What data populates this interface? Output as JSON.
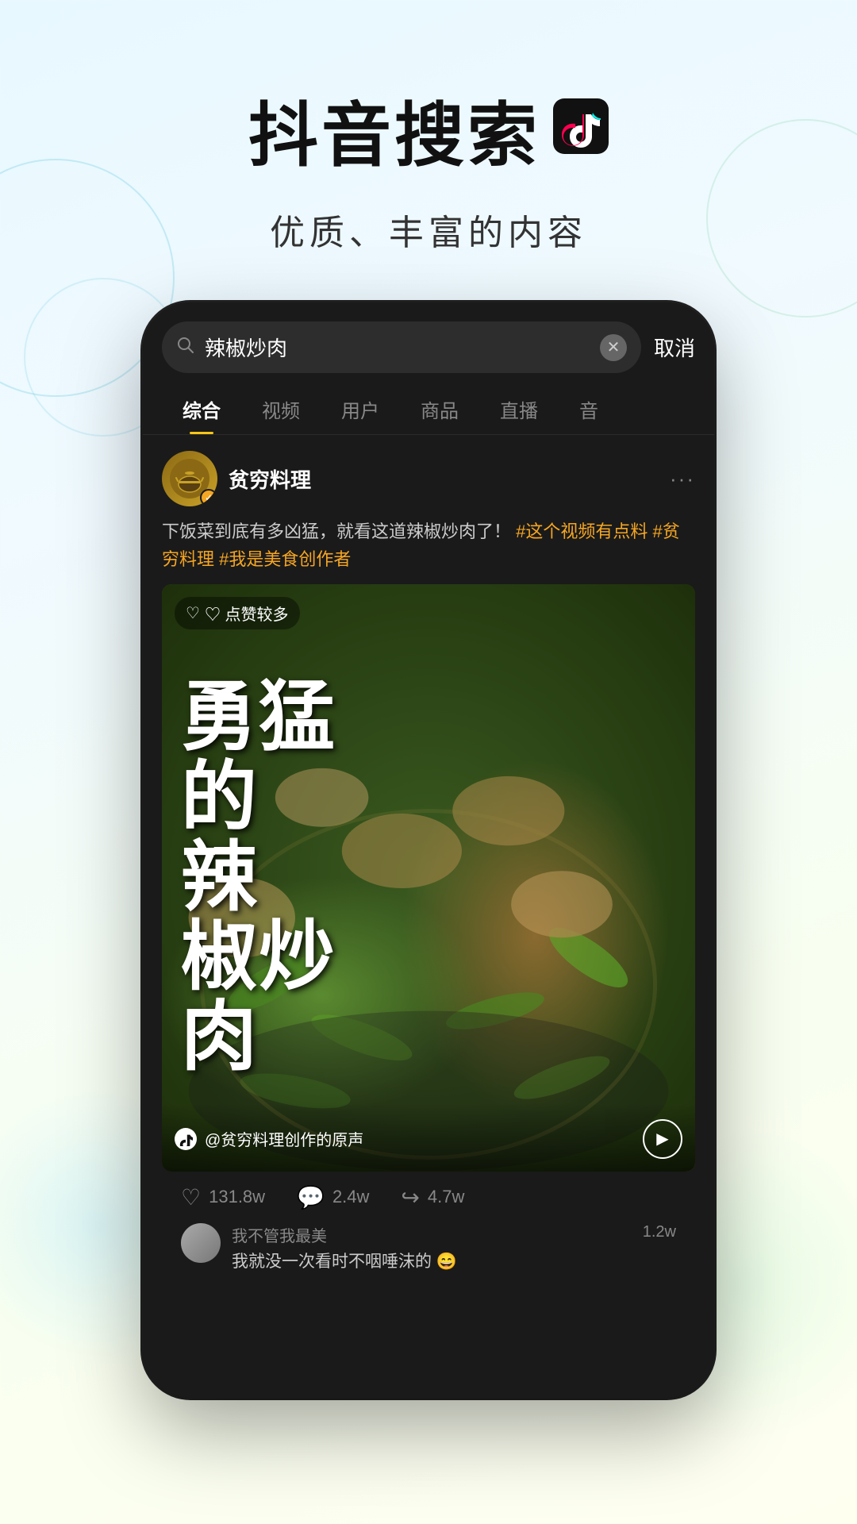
{
  "header": {
    "main_title": "抖音搜索",
    "tiktok_symbol": "♪",
    "subtitle": "优质、丰富的内容"
  },
  "phone": {
    "search_bar": {
      "query": "辣椒炒肉",
      "cancel_label": "取消"
    },
    "tabs": [
      {
        "label": "综合",
        "active": true
      },
      {
        "label": "视频",
        "active": false
      },
      {
        "label": "用户",
        "active": false
      },
      {
        "label": "商品",
        "active": false
      },
      {
        "label": "直播",
        "active": false
      },
      {
        "label": "音",
        "active": false
      }
    ],
    "post": {
      "username": "贫穷料理",
      "verified": true,
      "description": "下饭菜到底有多凶猛，就看这道辣椒炒肉了！",
      "hashtags": "#这个视频有点料 #贫穷料理 #我是美食创作者",
      "video": {
        "likes_badge": "♡ 点赞较多",
        "big_text_line1": "勇猛",
        "big_text_line2": "的",
        "big_text_line3": "辣",
        "big_text_line4": "椒炒",
        "big_text_line5": "肉",
        "sound_text": "@贫穷料理创作的原声"
      },
      "stats": {
        "likes": "131.8w",
        "comments": "2.4w",
        "shares": "4.7w"
      },
      "comment": {
        "user": "我不管我最美",
        "text": "我就没一次看时不咽唾沫的 😄",
        "count": "1.2w"
      }
    }
  }
}
